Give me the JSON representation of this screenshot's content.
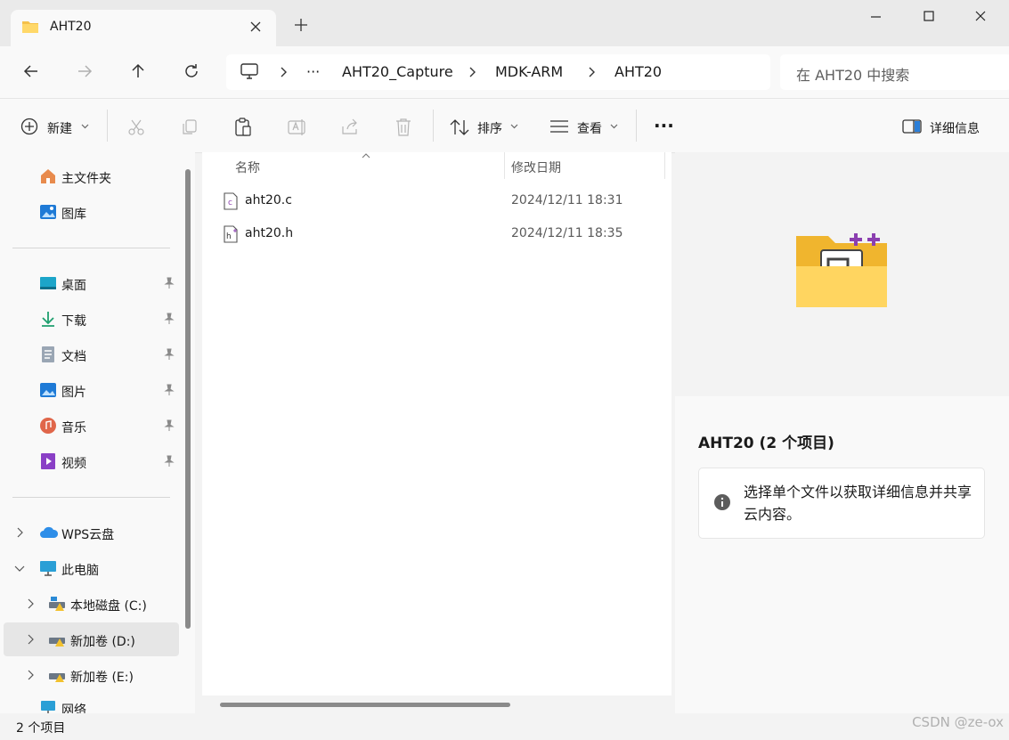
{
  "window": {
    "tab_title": "AHT20",
    "tab_icon": "folder-icon",
    "new_tab_icon": "plus-icon"
  },
  "nav": {
    "breadcrumb": [
      "AHT20_Capture",
      "MDK-ARM",
      "AHT20"
    ],
    "overflow": "···",
    "search_placeholder": "在 AHT20 中搜索"
  },
  "toolbar": {
    "new_label": "新建",
    "sort_label": "排序",
    "view_label": "查看",
    "more_label": "···",
    "details_label": "详细信息"
  },
  "sidebar": {
    "quick": [
      {
        "label": "主文件夹",
        "icon": "home-icon"
      },
      {
        "label": "图库",
        "icon": "gallery-icon"
      }
    ],
    "pinned": [
      {
        "label": "桌面",
        "icon": "desktop-icon"
      },
      {
        "label": "下载",
        "icon": "download-icon"
      },
      {
        "label": "文档",
        "icon": "document-icon"
      },
      {
        "label": "图片",
        "icon": "pictures-icon"
      },
      {
        "label": "音乐",
        "icon": "music-icon"
      },
      {
        "label": "视频",
        "icon": "video-icon"
      }
    ],
    "tree": [
      {
        "label": "WPS云盘",
        "icon": "cloud-icon"
      },
      {
        "label": "此电脑",
        "icon": "computer-icon"
      },
      {
        "label": "本地磁盘 (C:)",
        "icon": "drive-icon"
      },
      {
        "label": "新加卷 (D:)",
        "icon": "drive-icon"
      },
      {
        "label": "新加卷 (E:)",
        "icon": "drive-icon"
      },
      {
        "label": "网络",
        "icon": "network-icon"
      }
    ]
  },
  "filelist": {
    "col_name": "名称",
    "col_date": "修改日期",
    "files": [
      {
        "name": "aht20.c",
        "date": "2024/12/11 18:31",
        "icon": "c-file-icon"
      },
      {
        "name": "aht20.h",
        "date": "2024/12/11 18:35",
        "icon": "h-file-icon"
      }
    ]
  },
  "preview": {
    "title": "AHT20 (2 个项目)",
    "info": "选择单个文件以获取详细信息并共享云内容。"
  },
  "status": {
    "item_count": "2 个项目",
    "watermark": "CSDN @ze-ox"
  }
}
